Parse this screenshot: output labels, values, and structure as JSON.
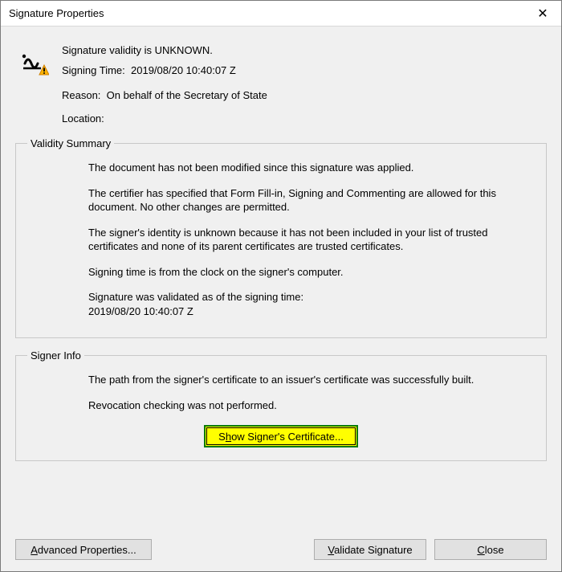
{
  "window": {
    "title": "Signature Properties",
    "close_glyph": "✕"
  },
  "header": {
    "validity_line": "Signature validity is UNKNOWN.",
    "signing_time_label": "Signing Time:",
    "signing_time_value": "2019/08/20 10:40:07 Z",
    "reason_label": "Reason:",
    "reason_value": "On behalf of the Secretary of State",
    "location_label": "Location:",
    "location_value": ""
  },
  "validity_summary": {
    "legend": "Validity Summary",
    "line1": "The document has not been modified since this signature was applied.",
    "line2": "The certifier has specified that Form Fill-in, Signing and Commenting are allowed for this document. No other changes are permitted.",
    "line3": "The signer's identity is unknown because it has not been included in your list of trusted certificates and none of its parent certificates are trusted certificates.",
    "line4": "Signing time is from the clock on the signer's computer.",
    "line5a": "Signature was validated as of the signing time:",
    "line5b": "2019/08/20 10:40:07 Z"
  },
  "signer_info": {
    "legend": "Signer Info",
    "line1": "The path from the signer's certificate to an issuer's certificate was successfully built.",
    "line2": "Revocation checking was not performed.",
    "show_cert_pre": "S",
    "show_cert_u": "h",
    "show_cert_post": "ow Signer's Certificate..."
  },
  "footer": {
    "adv_u": "A",
    "adv_post": "dvanced Properties...",
    "val_u": "V",
    "val_post": "alidate Signature",
    "close_u": "C",
    "close_post": "lose"
  }
}
